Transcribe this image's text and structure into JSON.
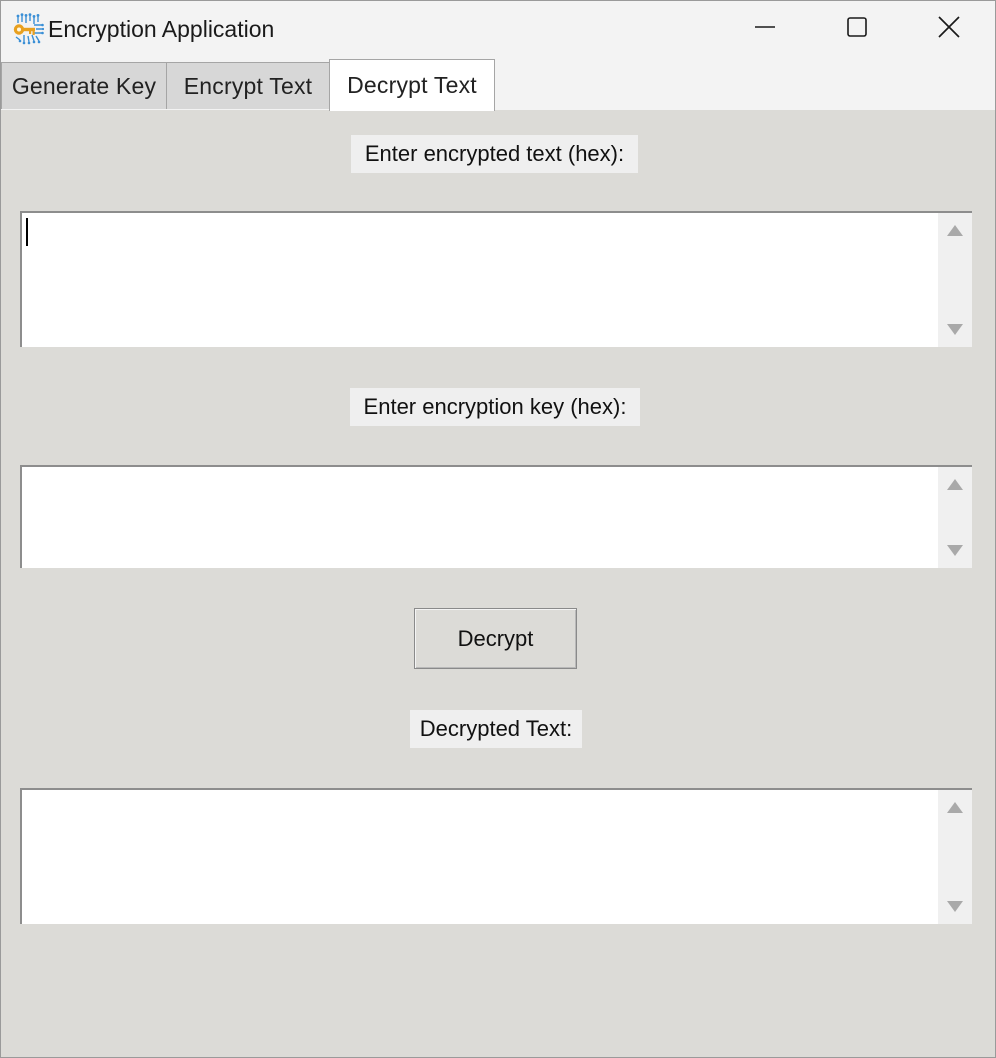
{
  "window": {
    "title": "Encryption Application",
    "icon": "key-circuit-icon",
    "controls": [
      "minimize-icon",
      "maximize-icon",
      "close-icon"
    ]
  },
  "tabs": [
    {
      "label": "Generate Key",
      "active": false
    },
    {
      "label": "Encrypt Text",
      "active": false
    },
    {
      "label": "Decrypt Text",
      "active": true
    }
  ],
  "decrypt": {
    "encrypted_label": "Enter encrypted text (hex):",
    "encrypted_value": "",
    "key_label": "Enter encryption key (hex):",
    "key_value": "",
    "button_label": "Decrypt",
    "output_label": "Decrypted Text:",
    "output_value": ""
  },
  "colors": {
    "panel_bg": "#dcdbd7",
    "label_bg": "#efefef",
    "tab_inactive": "#d7d7d7",
    "tab_active": "#ffffff",
    "icon_accent": "#e8a01f",
    "icon_circuit": "#3a8fd6"
  }
}
